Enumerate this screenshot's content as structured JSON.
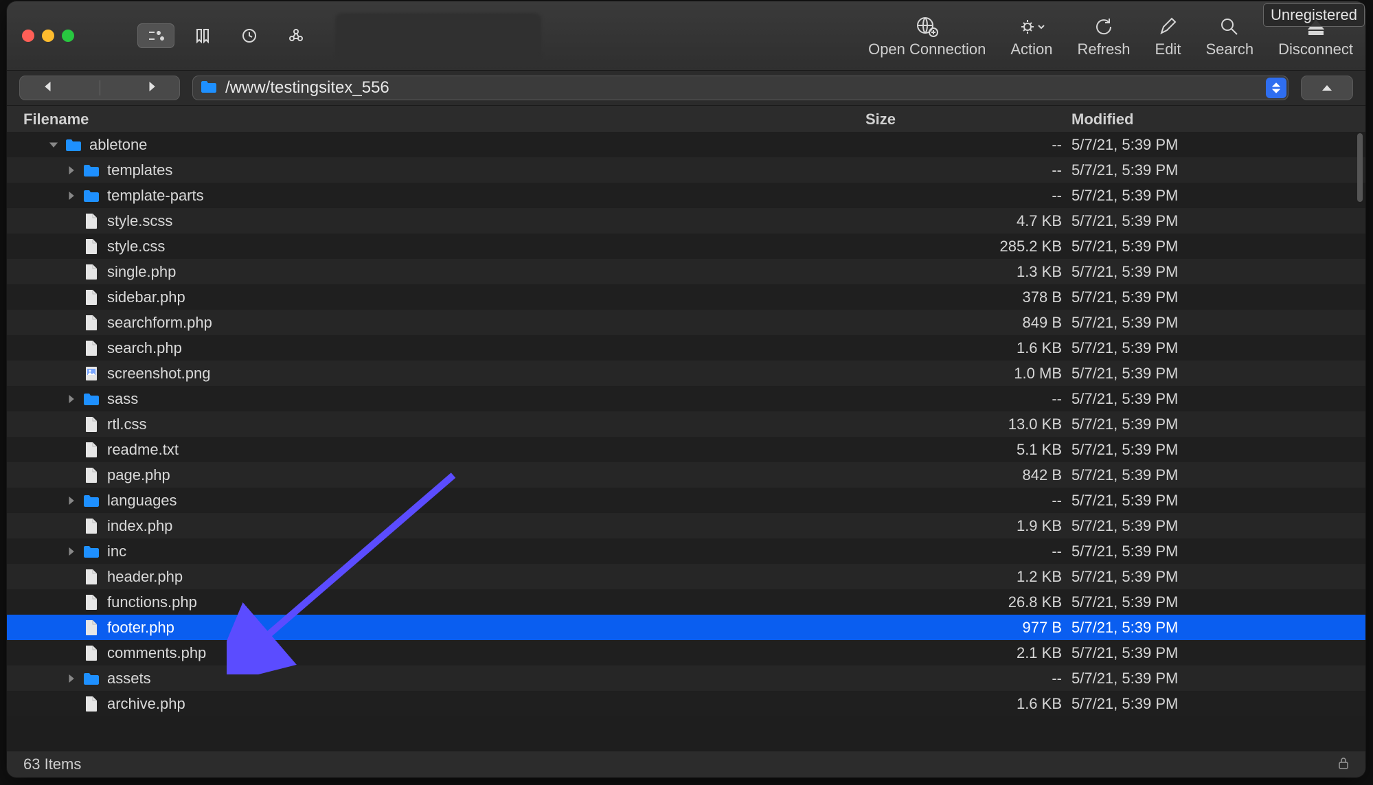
{
  "badge": "Unregistered",
  "toolbar": {
    "open_connection": "Open Connection",
    "action": "Action",
    "refresh": "Refresh",
    "edit": "Edit",
    "search": "Search",
    "disconnect": "Disconnect"
  },
  "path": "/www/testingsitex_556",
  "columns": {
    "filename": "Filename",
    "size": "Size",
    "modified": "Modified"
  },
  "status_text": "63 Items",
  "entries": [
    {
      "name": "abletone",
      "kind": "folder",
      "size": "--",
      "modified": "5/7/21, 5:39 PM",
      "depth": 0,
      "expanded": true
    },
    {
      "name": "templates",
      "kind": "folder",
      "size": "--",
      "modified": "5/7/21, 5:39 PM",
      "depth": 1,
      "expanded": false
    },
    {
      "name": "template-parts",
      "kind": "folder",
      "size": "--",
      "modified": "5/7/21, 5:39 PM",
      "depth": 1,
      "expanded": false
    },
    {
      "name": "style.scss",
      "kind": "file",
      "size": "4.7 KB",
      "modified": "5/7/21, 5:39 PM",
      "depth": 1
    },
    {
      "name": "style.css",
      "kind": "file",
      "size": "285.2 KB",
      "modified": "5/7/21, 5:39 PM",
      "depth": 1
    },
    {
      "name": "single.php",
      "kind": "file",
      "size": "1.3 KB",
      "modified": "5/7/21, 5:39 PM",
      "depth": 1
    },
    {
      "name": "sidebar.php",
      "kind": "file",
      "size": "378 B",
      "modified": "5/7/21, 5:39 PM",
      "depth": 1
    },
    {
      "name": "searchform.php",
      "kind": "file",
      "size": "849 B",
      "modified": "5/7/21, 5:39 PM",
      "depth": 1
    },
    {
      "name": "search.php",
      "kind": "file",
      "size": "1.6 KB",
      "modified": "5/7/21, 5:39 PM",
      "depth": 1
    },
    {
      "name": "screenshot.png",
      "kind": "image",
      "size": "1.0 MB",
      "modified": "5/7/21, 5:39 PM",
      "depth": 1
    },
    {
      "name": "sass",
      "kind": "folder",
      "size": "--",
      "modified": "5/7/21, 5:39 PM",
      "depth": 1,
      "expanded": false
    },
    {
      "name": "rtl.css",
      "kind": "file",
      "size": "13.0 KB",
      "modified": "5/7/21, 5:39 PM",
      "depth": 1
    },
    {
      "name": "readme.txt",
      "kind": "file",
      "size": "5.1 KB",
      "modified": "5/7/21, 5:39 PM",
      "depth": 1
    },
    {
      "name": "page.php",
      "kind": "file",
      "size": "842 B",
      "modified": "5/7/21, 5:39 PM",
      "depth": 1
    },
    {
      "name": "languages",
      "kind": "folder",
      "size": "--",
      "modified": "5/7/21, 5:39 PM",
      "depth": 1,
      "expanded": false
    },
    {
      "name": "index.php",
      "kind": "file",
      "size": "1.9 KB",
      "modified": "5/7/21, 5:39 PM",
      "depth": 1
    },
    {
      "name": "inc",
      "kind": "folder",
      "size": "--",
      "modified": "5/7/21, 5:39 PM",
      "depth": 1,
      "expanded": false
    },
    {
      "name": "header.php",
      "kind": "file",
      "size": "1.2 KB",
      "modified": "5/7/21, 5:39 PM",
      "depth": 1
    },
    {
      "name": "functions.php",
      "kind": "file",
      "size": "26.8 KB",
      "modified": "5/7/21, 5:39 PM",
      "depth": 1
    },
    {
      "name": "footer.php",
      "kind": "file",
      "size": "977 B",
      "modified": "5/7/21, 5:39 PM",
      "depth": 1,
      "selected": true
    },
    {
      "name": "comments.php",
      "kind": "file",
      "size": "2.1 KB",
      "modified": "5/7/21, 5:39 PM",
      "depth": 1
    },
    {
      "name": "assets",
      "kind": "folder",
      "size": "--",
      "modified": "5/7/21, 5:39 PM",
      "depth": 1,
      "expanded": false
    },
    {
      "name": "archive.php",
      "kind": "file",
      "size": "1.6 KB",
      "modified": "5/7/21, 5:39 PM",
      "depth": 1
    }
  ]
}
